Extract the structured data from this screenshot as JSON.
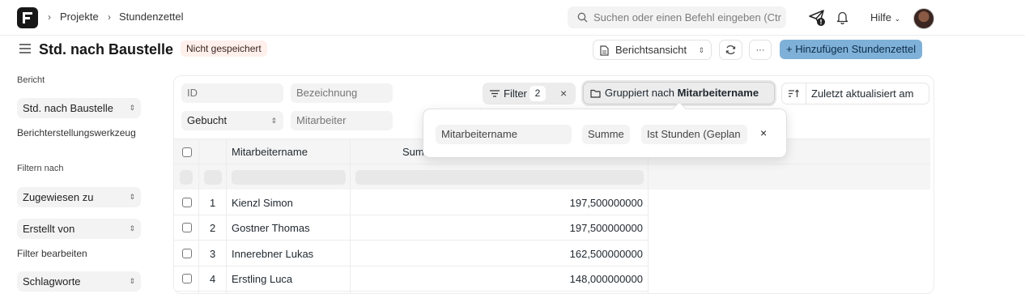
{
  "navbar": {
    "breadcrumbs": [
      "Projekte",
      "Stundenzettel"
    ],
    "search_placeholder": "Suchen oder einen Befehl eingeben (Ctr",
    "help_label": "Hilfe"
  },
  "page": {
    "title": "Std. nach Baustelle",
    "status_badge": "Nicht gespeichert",
    "view_button": "Berichtsansicht",
    "more_label": "···",
    "primary_button": "+ Hinzufügen Stundenzettel"
  },
  "sidebar": {
    "report_label": "Bericht",
    "report_value": "Std. nach Baustelle",
    "builder_link": "Berichterstellungswerkzeug",
    "filter_by_label": "Filtern nach",
    "filter_options": [
      "Zugewiesen zu",
      "Erstellt von"
    ],
    "edit_filters_link": "Filter bearbeiten",
    "tags_option": "Schlagworte"
  },
  "filters": {
    "id_placeholder": "ID",
    "name_placeholder": "Bezeichnung",
    "booked_value": "Gebucht",
    "employee_placeholder": "Mitarbeiter",
    "filter_label": "Filter",
    "filter_count": "2",
    "group_by_prefix": "Gruppiert nach",
    "group_by_field": "Mitarbeitername",
    "sort_label": "Zuletzt aktualisiert am"
  },
  "group_popover": {
    "field": "Mitarbeitername",
    "aggregate": "Summe",
    "column": "Ist Stunden (Geplan"
  },
  "table": {
    "columns": [
      "Mitarbeitername",
      "Summe"
    ],
    "rows": [
      {
        "index": "1",
        "name": "Kienzl Simon",
        "sum": "197,500000000"
      },
      {
        "index": "2",
        "name": "Gostner Thomas",
        "sum": "197,500000000"
      },
      {
        "index": "3",
        "name": "Innerebner Lukas",
        "sum": "162,500000000"
      },
      {
        "index": "4",
        "name": "Erstling Luca",
        "sum": "148,000000000"
      }
    ]
  }
}
